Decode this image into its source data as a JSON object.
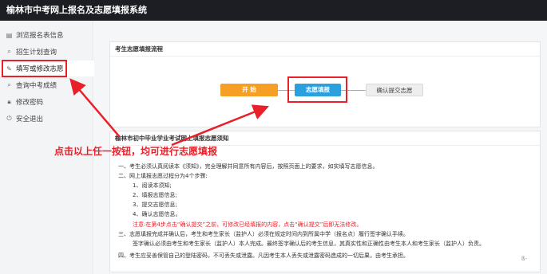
{
  "header": {
    "title": "榆林市中考网上报名及志愿填报系统"
  },
  "sidebar": {
    "items": [
      {
        "label": "浏览报名表信息",
        "icon": "document-icon"
      },
      {
        "label": "招生计划查询",
        "icon": "search-icon"
      },
      {
        "label": "填写或修改志愿",
        "icon": "pencil-icon"
      },
      {
        "label": "查询中考成绩",
        "icon": "search-icon"
      },
      {
        "label": "修改密码",
        "icon": "lock-icon"
      },
      {
        "label": "安全退出",
        "icon": "power-icon"
      }
    ]
  },
  "flow_panel": {
    "title": "考生志愿填报流程",
    "start_label": "开 始",
    "fill_label": "志愿填报",
    "confirm_label": "确认提交志愿"
  },
  "notice_panel": {
    "title": "榆林市初中毕业学业考试网上填报志愿须知",
    "lines": [
      "一、考生必须认真阅读本《须知》，完全理解并同意所有内容后，按照页面上的要求，如实填写志愿信息。",
      "二、网上填报志愿过程分为4个步骤:",
      "1、阅读本须知;",
      "2、填报志愿信息;",
      "3、提交志愿信息;",
      "4、确认志愿信息。",
      "注意:在第4步点击“确认提交”之前，可修改已经填报的内容，点击“确认提交”后即无法修改。",
      "三、志愿填报完成并确认后，考生和考生家长（监护人）必须在规定时间内到所属中学（报名点）履行签字确认手续。",
      "签字确认必须由考生和考生家长（监护人）本人完成。最终签字确认后的考生信息，其真实性和正确性由考生本人和考生家长（监护人）负责。",
      "四、考生应妥善保管自己的登陆密码，不可丢失或泄露。凡因考生本人丢失或泄露密码造成的一切后果，由考生承担。"
    ]
  },
  "callout": {
    "text": "点击以上任一按钮，均可进行志愿填报"
  },
  "page_number": "ß-",
  "colors": {
    "accent_red": "#e8202a",
    "orange": "#f5a025",
    "blue": "#2aa0de",
    "topbar": "#1c1e24"
  }
}
